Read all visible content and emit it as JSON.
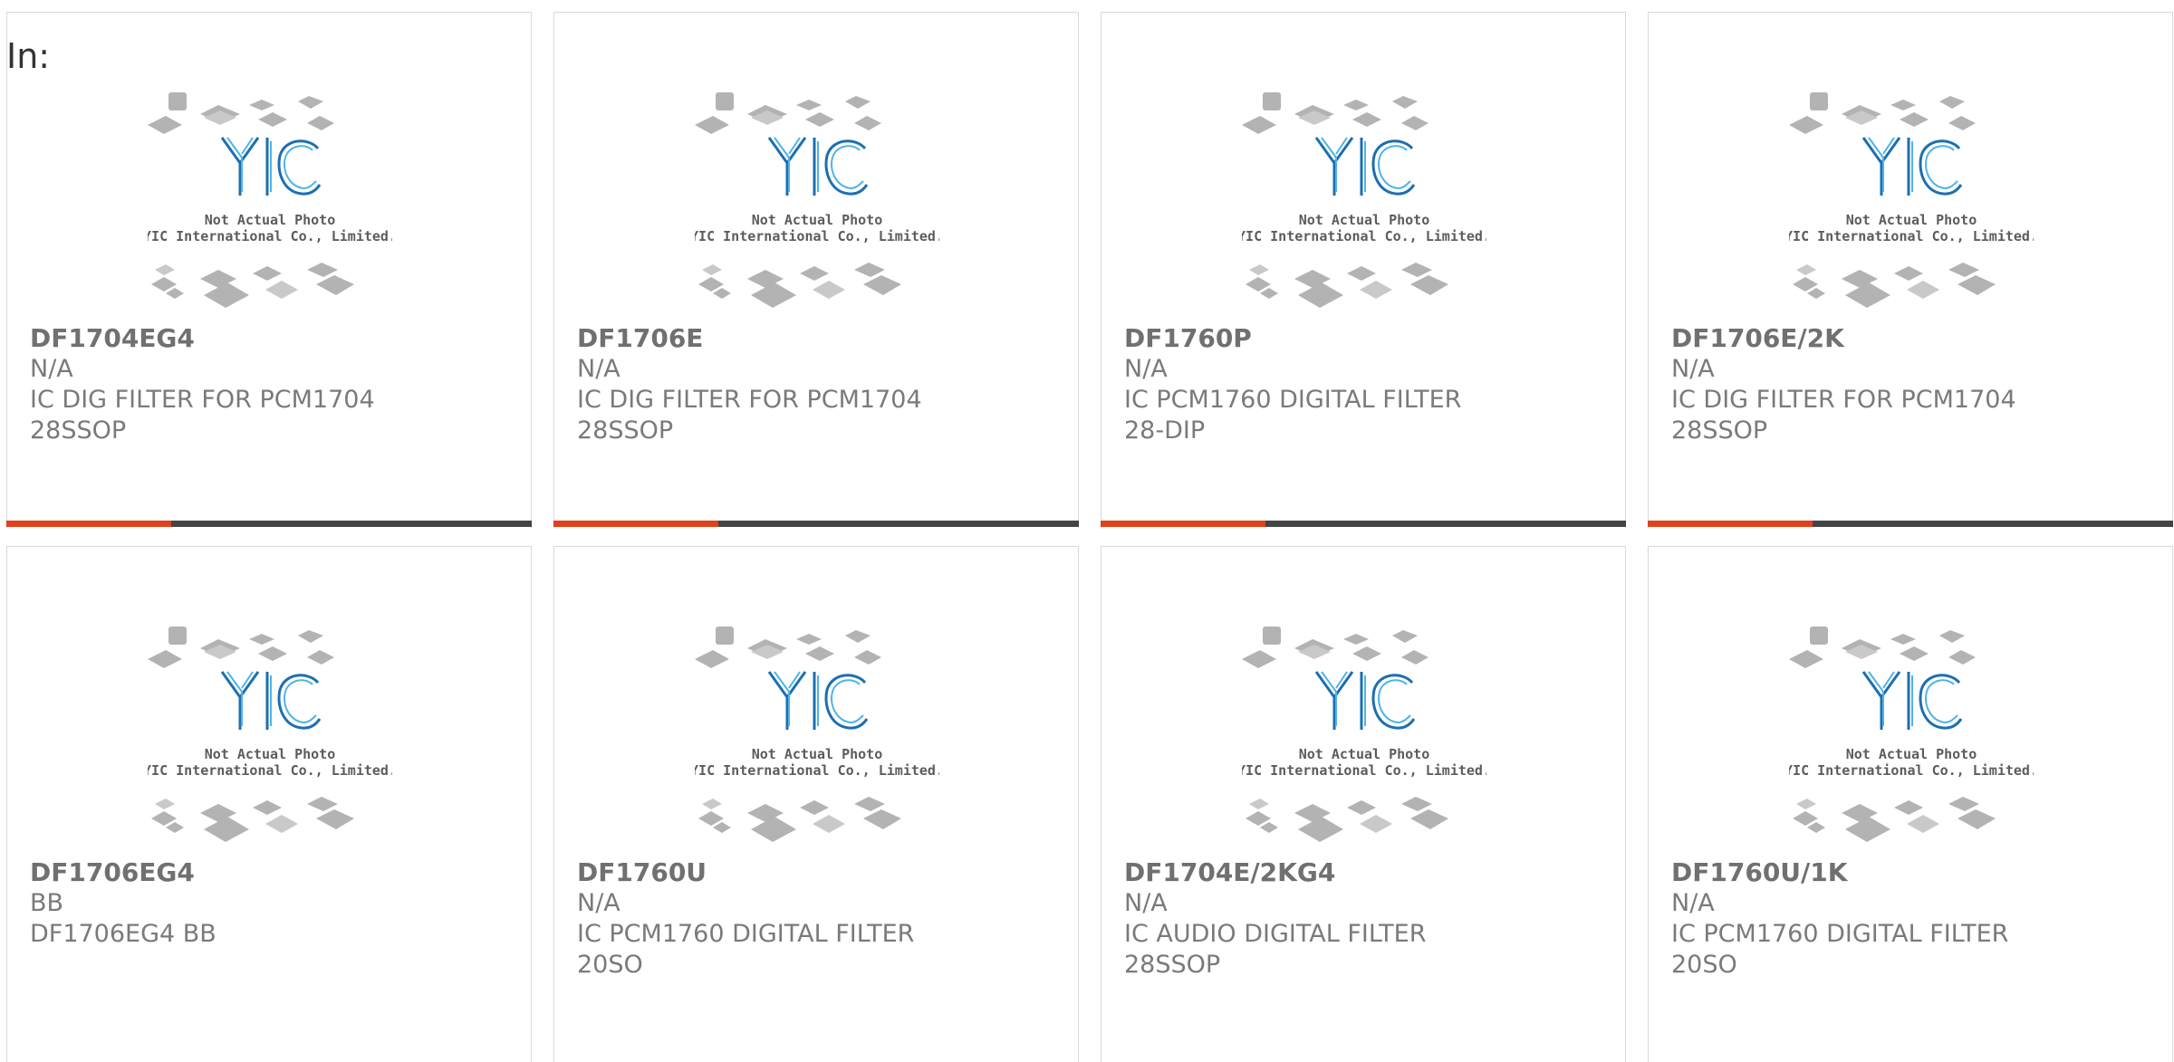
{
  "page": {
    "in_label": "In:"
  },
  "photo": {
    "line1": "Not Actual Photo",
    "line2": "YIC International Co., Limited."
  },
  "colors": {
    "accent": "#e0411c",
    "bar": "#444444",
    "logo_blue": "#1d6fb0",
    "logo_light_blue": "#4fb3e6"
  },
  "products": [
    {
      "part": "DF1704EG4",
      "mfr": "N/A",
      "desc": "IC DIG FILTER FOR PCM1704 28SSOP",
      "has_bar": true
    },
    {
      "part": "DF1706E",
      "mfr": "N/A",
      "desc": "IC DIG FILTER FOR PCM1704 28SSOP",
      "has_bar": true
    },
    {
      "part": "DF1760P",
      "mfr": "N/A",
      "desc": "IC PCM1760 DIGITAL FILTER 28-DIP",
      "has_bar": true
    },
    {
      "part": "DF1706E/2K",
      "mfr": "N/A",
      "desc": "IC DIG FILTER FOR PCM1704 28SSOP",
      "has_bar": true
    },
    {
      "part": "DF1706EG4",
      "mfr": "BB",
      "desc": "DF1706EG4 BB",
      "has_bar": false
    },
    {
      "part": "DF1760U",
      "mfr": "N/A",
      "desc": "IC PCM1760 DIGITAL FILTER 20SO",
      "has_bar": false
    },
    {
      "part": "DF1704E/2KG4",
      "mfr": "N/A",
      "desc": "IC AUDIO DIGITAL FILTER 28SSOP",
      "has_bar": false
    },
    {
      "part": "DF1760U/1K",
      "mfr": "N/A",
      "desc": "IC PCM1760 DIGITAL FILTER 20SO",
      "has_bar": false
    }
  ]
}
